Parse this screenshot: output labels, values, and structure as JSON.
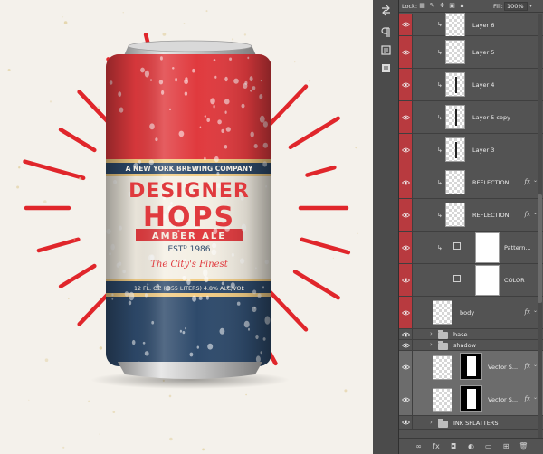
{
  "canvas": {
    "can": {
      "brewery": "A NEW YORK BREWING COMPANY",
      "brand_line1": "DESIGNER",
      "brand_line2": "HOPS",
      "style": "AMBER ALE",
      "established": "ESTᴰ 1986",
      "tagline": "The City's Finest",
      "volume": "12 FL. OZ (.355 LITERS) 4.8% ALC/VOL"
    },
    "colors": {
      "can_red": "#e03a3e",
      "can_navy": "#2e4a6b",
      "can_cream": "#f4efe4",
      "can_gold": "#f2cd85",
      "burst_red": "#e0262b",
      "background": "#f4f1eb"
    }
  },
  "tool_strip": {
    "icons": [
      "panel-arrows-icon",
      "paragraph-icon",
      "libraries-icon",
      "notes-icon"
    ]
  },
  "layers_panel": {
    "lock_label": "Lock:",
    "fill_label": "Fill:",
    "fill_value": "100%",
    "layers": [
      {
        "name": "Layer 6",
        "kind": "pixel",
        "clipped": true,
        "red_eye": true,
        "selected": false,
        "fx": false
      },
      {
        "name": "Layer 5",
        "kind": "pixel",
        "clipped": true,
        "red_eye": true,
        "selected": false,
        "fx": false
      },
      {
        "name": "Layer 4",
        "kind": "pixel-line",
        "clipped": true,
        "red_eye": true,
        "selected": false,
        "fx": false
      },
      {
        "name": "Layer 5 copy",
        "kind": "pixel-line",
        "clipped": true,
        "red_eye": true,
        "selected": false,
        "fx": false
      },
      {
        "name": "Layer 3",
        "kind": "pixel-line",
        "clipped": true,
        "red_eye": true,
        "selected": false,
        "fx": false
      },
      {
        "name": "REFLECTION",
        "kind": "pixel",
        "clipped": true,
        "red_eye": true,
        "selected": false,
        "fx": true
      },
      {
        "name": "REFLECTION",
        "kind": "pixel",
        "clipped": true,
        "red_eye": true,
        "selected": false,
        "fx": true
      },
      {
        "name": "Pattern...",
        "kind": "fill",
        "clipped": true,
        "red_eye": true,
        "selected": false,
        "fx": false
      },
      {
        "name": "COLOR",
        "kind": "fill",
        "clipped": false,
        "red_eye": true,
        "selected": false,
        "fx": false
      },
      {
        "name": "body",
        "kind": "pixel",
        "clipped": false,
        "red_eye": true,
        "selected": false,
        "fx": true
      },
      {
        "name": "base",
        "kind": "group",
        "clipped": false,
        "red_eye": false,
        "selected": false,
        "fx": false
      },
      {
        "name": "shadow",
        "kind": "group",
        "clipped": false,
        "red_eye": false,
        "selected": false,
        "fx": false
      },
      {
        "name": "Vector S...",
        "kind": "vector",
        "clipped": false,
        "red_eye": false,
        "selected": true,
        "fx": true
      },
      {
        "name": "Vector S...",
        "kind": "vector",
        "clipped": false,
        "red_eye": false,
        "selected": true,
        "fx": true
      },
      {
        "name": "INK SPLATTERS",
        "kind": "group",
        "clipped": false,
        "red_eye": false,
        "selected": false,
        "fx": false
      }
    ],
    "footer_icons": [
      "link-icon",
      "fx-icon",
      "mask-icon",
      "adjustment-icon",
      "folder-icon",
      "new-layer-icon",
      "trash-icon"
    ],
    "fx_label": "fx"
  }
}
